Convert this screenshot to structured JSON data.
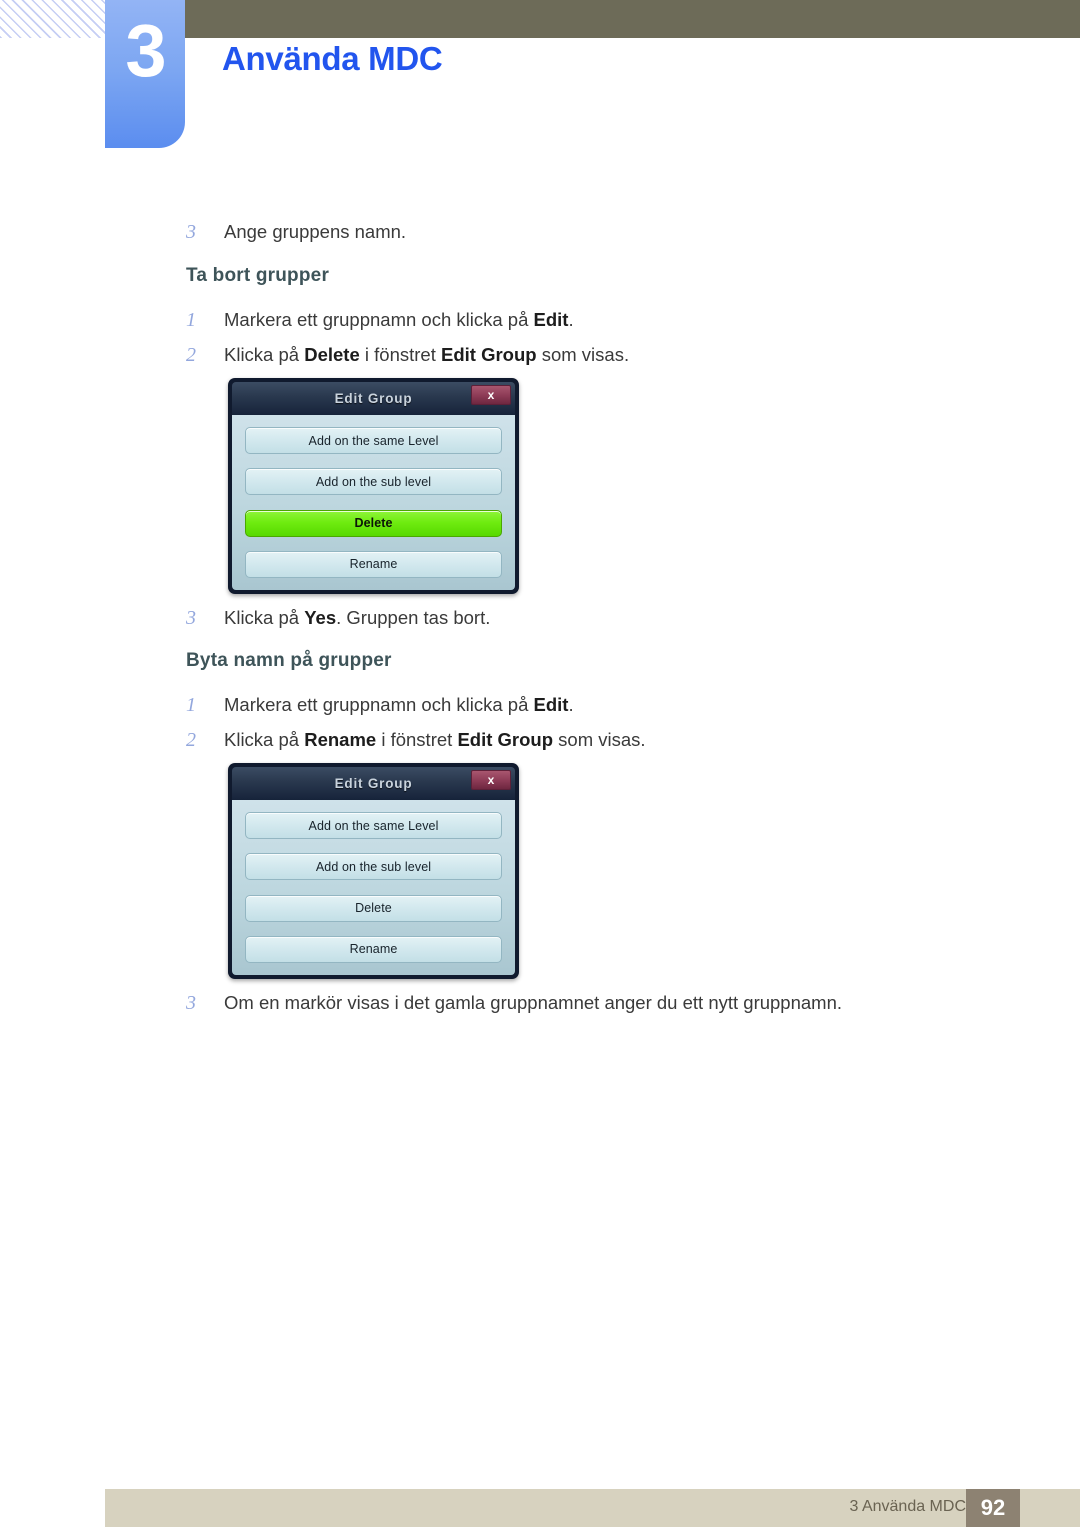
{
  "header": {
    "chapter_number": "3",
    "chapter_title": "Använda MDC",
    "accent_blue": "#2255ee",
    "tab_blue": "#7ca6f2",
    "olive_bar": "#6d6b58"
  },
  "body": {
    "step_a": {
      "num": "3",
      "text_html": "Ange gruppens namn."
    },
    "heading_delete": "Ta bort grupper",
    "delete_steps": [
      {
        "num": "1",
        "text_html": "Markera ett gruppnamn och klicka på <b>Edit</b>."
      },
      {
        "num": "2",
        "text_html": "Klicka på <b>Delete</b> i fönstret <b>Edit Group</b> som visas."
      }
    ],
    "step_after_delete": {
      "num": "3",
      "text_html": "Klicka på <b>Yes</b>. Gruppen tas bort."
    },
    "heading_rename": "Byta namn på grupper",
    "rename_steps": [
      {
        "num": "1",
        "text_html": "Markera ett gruppnamn och klicka på <b>Edit</b>."
      },
      {
        "num": "2",
        "text_html": "Klicka på <b>Rename</b> i fönstret <b>Edit Group</b> som visas."
      }
    ],
    "step_after_rename": {
      "num": "3",
      "text_html": "Om en markör visas i det gamla gruppnamnet anger du ett nytt gruppnamn."
    }
  },
  "dialog_delete": {
    "title": "Edit Group",
    "close_label": "x",
    "buttons": [
      {
        "label": "Add on the same Level",
        "highlighted": false
      },
      {
        "label": "Add on the sub level",
        "highlighted": false
      },
      {
        "label": "Delete",
        "highlighted": true
      },
      {
        "label": "Rename",
        "highlighted": false
      }
    ],
    "highlight_color": "#6fec10",
    "close_color": "#8c3a55"
  },
  "dialog_rename": {
    "title": "Edit Group",
    "close_label": "x",
    "buttons": [
      {
        "label": "Add on the same Level",
        "highlighted": false
      },
      {
        "label": "Add on the sub level",
        "highlighted": false
      },
      {
        "label": "Delete",
        "highlighted": false
      },
      {
        "label": "Rename",
        "highlighted": false
      }
    ],
    "close_color": "#8c3a55"
  },
  "footer": {
    "label": "3 Använda MDC",
    "page_number": "92",
    "bar_color": "#d7d2bf",
    "page_box_color": "#8d8272"
  }
}
